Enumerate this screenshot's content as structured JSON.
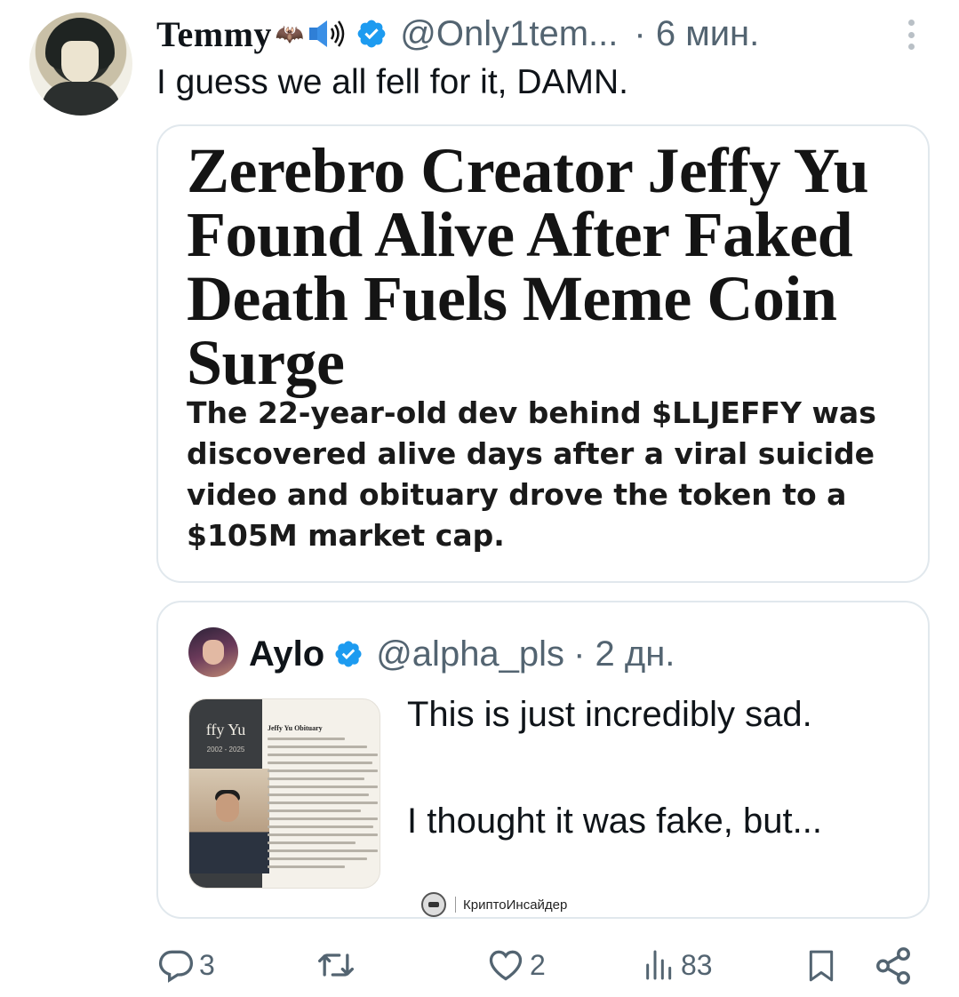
{
  "author": {
    "name": "Temmy",
    "deco": "🦇",
    "handle": "@Only1tem...",
    "time": "· 6 мин."
  },
  "tweet": {
    "text": "I guess we all fell for it, DAMN."
  },
  "article": {
    "headline": "Zerebro Creator Jeffy Yu Found Alive After Faked Death Fuels Meme Coin Surge",
    "subhead": "The 22-year-old dev behind $LLJEFFY was discovered alive days after a viral suicide video and obituary drove the token to a $105M market cap."
  },
  "quote": {
    "name": "Aylo",
    "handle": "@alpha_pls",
    "time": "· 2 дн.",
    "text_line1": "This is just incredibly sad.",
    "text_line2": "I thought it was fake, but...",
    "thumbnail": {
      "name": "ffy Yu",
      "years": "2002 - 2025",
      "caption": "Jeffy Yu Obituary"
    },
    "watermark": "КриптоИнсайдер"
  },
  "actions": {
    "replies": "3",
    "retweets": "",
    "likes": "2",
    "views": "83"
  },
  "colors": {
    "verified": "#1d9bf0",
    "muted": "#536471",
    "border": "#e1e8ed"
  }
}
